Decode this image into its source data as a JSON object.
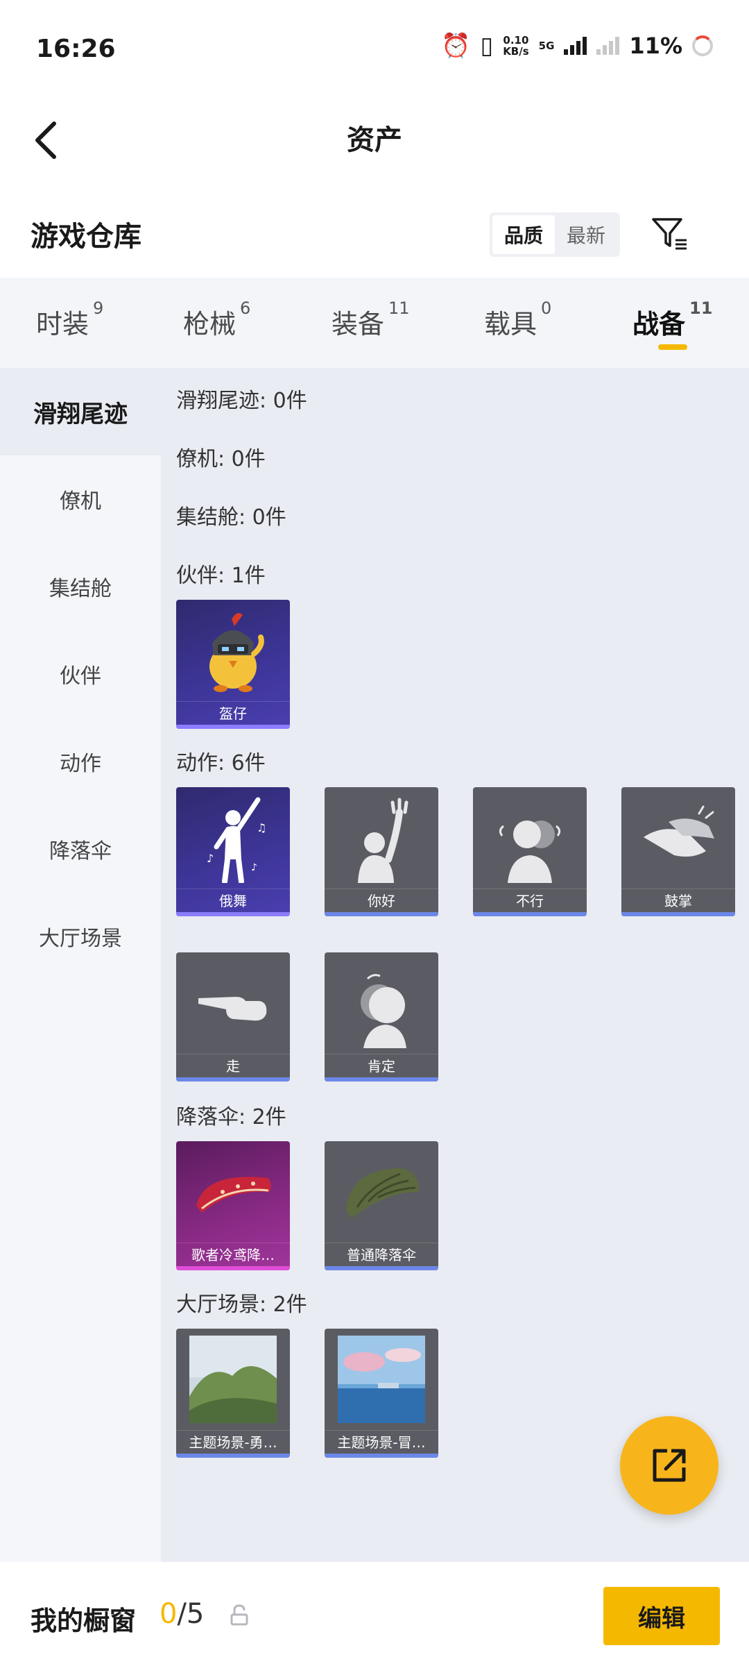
{
  "status_bar": {
    "time": "16:26",
    "speed_top": "0.10",
    "speed_unit": "KB/s",
    "network": "5G",
    "battery": "11%"
  },
  "header": {
    "title": "资产",
    "back_icon": "chevron-left-icon"
  },
  "warehouse": {
    "title": "游戏仓库",
    "sort_options": [
      "品质",
      "最新"
    ],
    "active_sort": "品质",
    "filter_icon": "filter-icon"
  },
  "tabs": [
    {
      "label": "时装",
      "count": "9"
    },
    {
      "label": "枪械",
      "count": "6"
    },
    {
      "label": "装备",
      "count": "11"
    },
    {
      "label": "载具",
      "count": "0"
    },
    {
      "label": "战备",
      "count": "11"
    }
  ],
  "active_tab": "战备",
  "sidebar": {
    "items": [
      "滑翔尾迹",
      "僚机",
      "集结舱",
      "伙伴",
      "动作",
      "降落伞",
      "大厅场景"
    ],
    "active": "滑翔尾迹"
  },
  "sections": [
    {
      "label": "滑翔尾迹: 0件",
      "items": []
    },
    {
      "label": "僚机: 0件",
      "items": []
    },
    {
      "label": "集结舱: 0件",
      "items": []
    },
    {
      "label": "伙伴: 1件",
      "items": [
        "盔仔"
      ]
    },
    {
      "label": "动作: 6件",
      "items": [
        "俄舞",
        "你好",
        "不行",
        "鼓掌",
        "走",
        "肯定"
      ]
    },
    {
      "label": "降落伞: 2件",
      "items": [
        "歌者冷鸢降…",
        "普通降落伞"
      ]
    },
    {
      "label": "大厅场景: 2件",
      "items": [
        "主题场景-勇…",
        "主题场景-冒…"
      ]
    }
  ],
  "colors": {
    "accent": "#f5b800",
    "fab": "#f7b51b",
    "card_gray": "#5b5c63",
    "card_bar": "#6d87e8"
  },
  "fab_icon": "share-out-icon",
  "bottom": {
    "title": "我的橱窗",
    "count_current": "0",
    "count_total": "/5",
    "lock_icon": "lock-icon",
    "edit_label": "编辑"
  }
}
